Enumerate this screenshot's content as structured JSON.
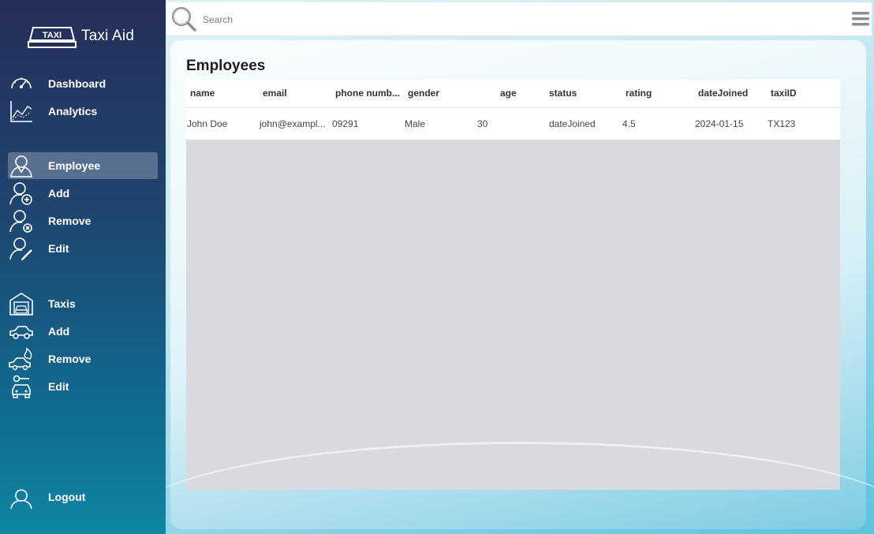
{
  "app": {
    "name": "Taxi Aid",
    "badge": "TAXI"
  },
  "sidebar": {
    "items": [
      {
        "label": "Dashboard",
        "icon": "speedometer-icon"
      },
      {
        "label": "Analytics",
        "icon": "chart-icon"
      },
      {
        "label": "Employee",
        "icon": "employee-icon",
        "active": true
      },
      {
        "label": "Add",
        "icon": "add-user-icon"
      },
      {
        "label": "Remove",
        "icon": "remove-user-icon"
      },
      {
        "label": "Edit",
        "icon": "edit-user-icon"
      },
      {
        "label": "Taxis",
        "icon": "garage-icon"
      },
      {
        "label": "Add",
        "icon": "car-icon"
      },
      {
        "label": "Remove",
        "icon": "car-remove-icon"
      },
      {
        "label": "Edit",
        "icon": "car-edit-icon"
      },
      {
        "label": "Logout",
        "icon": "logout-user-icon"
      }
    ]
  },
  "search": {
    "placeholder": "Search",
    "value": ""
  },
  "page": {
    "title": "Employees"
  },
  "table": {
    "columns": [
      "name",
      "email",
      "phone numb...",
      "gender",
      "age",
      "status",
      "rating",
      "dateJoined",
      "taxiID"
    ],
    "rows": [
      [
        "John Doe",
        "john@exampl...",
        "09291",
        "Male",
        "30",
        "dateJoined",
        "4.5",
        "2024-01-15",
        "TX123"
      ]
    ]
  },
  "colors": {
    "active": "#5a7394",
    "empty_area": "#d8dae0"
  }
}
